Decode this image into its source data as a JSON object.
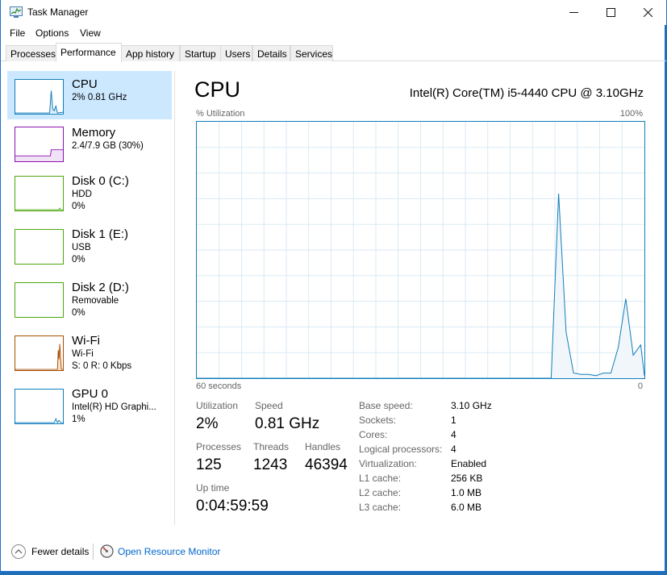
{
  "window": {
    "title": "Task Manager"
  },
  "menu": [
    "File",
    "Options",
    "View"
  ],
  "tabs": [
    "Processes",
    "Performance",
    "App history",
    "Startup",
    "Users",
    "Details",
    "Services"
  ],
  "sidebar": [
    {
      "name": "CPU",
      "sub1": "2% 0.81 GHz",
      "sub2": "",
      "color": "#117dbb"
    },
    {
      "name": "Memory",
      "sub1": "2.4/7.9 GB (30%)",
      "sub2": "",
      "color": "#8b12ae"
    },
    {
      "name": "Disk 0 (C:)",
      "sub1": "HDD",
      "sub2": "0%",
      "color": "#4da60c"
    },
    {
      "name": "Disk 1 (E:)",
      "sub1": "USB",
      "sub2": "0%",
      "color": "#4da60c"
    },
    {
      "name": "Disk 2 (D:)",
      "sub1": "Removable",
      "sub2": "0%",
      "color": "#4da60c"
    },
    {
      "name": "Wi-Fi",
      "sub1": "Wi-Fi",
      "sub2": "S: 0 R: 0 Kbps",
      "color": "#a74f01"
    },
    {
      "name": "GPU 0",
      "sub1": "Intel(R) HD Graphi...",
      "sub2": "1%",
      "color": "#117dbb"
    }
  ],
  "main": {
    "title": "CPU",
    "model": "Intel(R) Core(TM) i5-4440 CPU @ 3.10GHz",
    "graph_label": "% Utilization",
    "graph_max": "100%",
    "graph_span": "60 seconds",
    "graph_min": "0",
    "stats": {
      "utilization_label": "Utilization",
      "utilization": "2%",
      "speed_label": "Speed",
      "speed": "0.81 GHz",
      "processes_label": "Processes",
      "processes": "125",
      "threads_label": "Threads",
      "threads": "1243",
      "handles_label": "Handles",
      "handles": "46394",
      "uptime_label": "Up time",
      "uptime": "0:04:59:59"
    },
    "specs": [
      {
        "label": "Base speed:",
        "value": "3.10 GHz"
      },
      {
        "label": "Sockets:",
        "value": "1"
      },
      {
        "label": "Cores:",
        "value": "4"
      },
      {
        "label": "Logical processors:",
        "value": "4"
      },
      {
        "label": "Virtualization:",
        "value": "Enabled"
      },
      {
        "label": "L1 cache:",
        "value": "256 KB"
      },
      {
        "label": "L2 cache:",
        "value": "1.0 MB"
      },
      {
        "label": "L3 cache:",
        "value": "6.0 MB"
      }
    ]
  },
  "footer": {
    "fewer": "Fewer details",
    "monitor": "Open Resource Monitor"
  },
  "chart_data": {
    "type": "area",
    "xlabel": "60 seconds",
    "ylabel": "% Utilization",
    "ylim": [
      0,
      100
    ],
    "x": [
      -60,
      -12.5,
      -11.5,
      -10.5,
      -9.5,
      -8.5,
      -7.5,
      -6.5,
      -5.5,
      -4.5,
      -3.5,
      -2.5,
      -1.5,
      -0.5,
      0
    ],
    "values": [
      0,
      0,
      72,
      18,
      2,
      1.5,
      1.5,
      1,
      2,
      2,
      12,
      31,
      9,
      13,
      1
    ],
    "color": "#117dbb"
  }
}
